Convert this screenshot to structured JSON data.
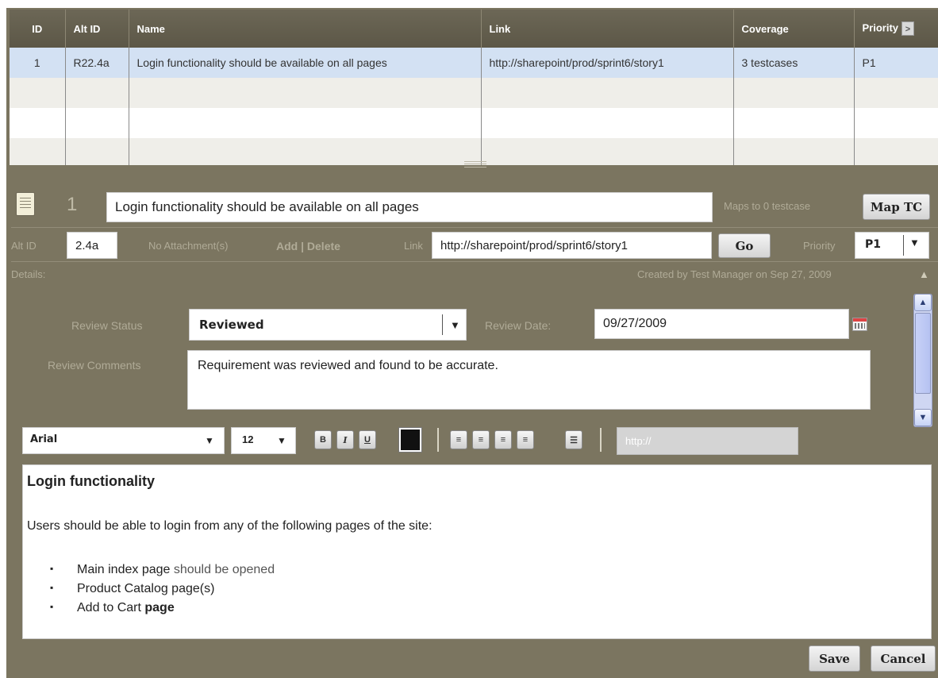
{
  "grid": {
    "columns": [
      "ID",
      "Alt ID",
      "Name",
      "Link",
      "Coverage",
      "Priority"
    ],
    "header_scroll_icon": "chevron-right-icon",
    "rows": [
      {
        "id": "1",
        "alt_id": "R22.4a",
        "name": "Login functionality should be available on all pages",
        "link": "http://sharepoint/prod/sprint6/story1",
        "coverage": "3 testcases",
        "priority": "P1"
      },
      {
        "id": "",
        "alt_id": "",
        "name": "",
        "link": "",
        "coverage": "",
        "priority": ""
      },
      {
        "id": "",
        "alt_id": "",
        "name": "",
        "link": "",
        "coverage": "",
        "priority": ""
      },
      {
        "id": "",
        "alt_id": "",
        "name": "",
        "link": "",
        "coverage": "",
        "priority": ""
      }
    ],
    "selected_color": "#d3e1f3",
    "header_color": "#615c4c"
  },
  "editor": {
    "icon": "notepad-icon",
    "id": "1",
    "title": "Login functionality should be available on all pages",
    "maps_text": "Maps to 0 testcase",
    "map_button": "Map TC",
    "alt_id_label": "Alt ID",
    "alt_id_value": "2.4a",
    "attachments_text": "No Attachment(s)",
    "attachments_actions": "Add | Delete",
    "link_label": "Link",
    "link_value": "http://sharepoint/prod/sprint6/story1",
    "go_button": "Go",
    "priority_label": "Priority",
    "priority_value": "P1",
    "details_label": "Details:",
    "created_text": "Created by Test Manager on Sep 27, 2009",
    "review_status_label": "Review Status",
    "review_status_value": "Reviewed",
    "review_date_label": "Review Date:",
    "review_date_value": "09/27/2009",
    "review_comments_label": "Review Comments",
    "review_comments_value": "Requirement was reviewed and found to be accurate."
  },
  "toolbar": {
    "font": "Arial",
    "size": "12",
    "bold": "B",
    "italic": "I",
    "underline": "U",
    "text_color": "#111111",
    "url_placeholder": "http://"
  },
  "content": {
    "heading": "Login functionality",
    "paragraph": "Users should be able to login from any of the following pages of the site:",
    "list": [
      {
        "main": "Main index page ",
        "rest": "should be opened"
      },
      {
        "main": "Product Catalog page(s)",
        "rest": ""
      },
      {
        "main": "Add to Cart ",
        "bold": "page"
      }
    ]
  },
  "footer": {
    "save": "Save",
    "cancel": "Cancel"
  },
  "colors": {
    "frame": "#7b7560",
    "accent_blue": "#d3e1f3"
  }
}
